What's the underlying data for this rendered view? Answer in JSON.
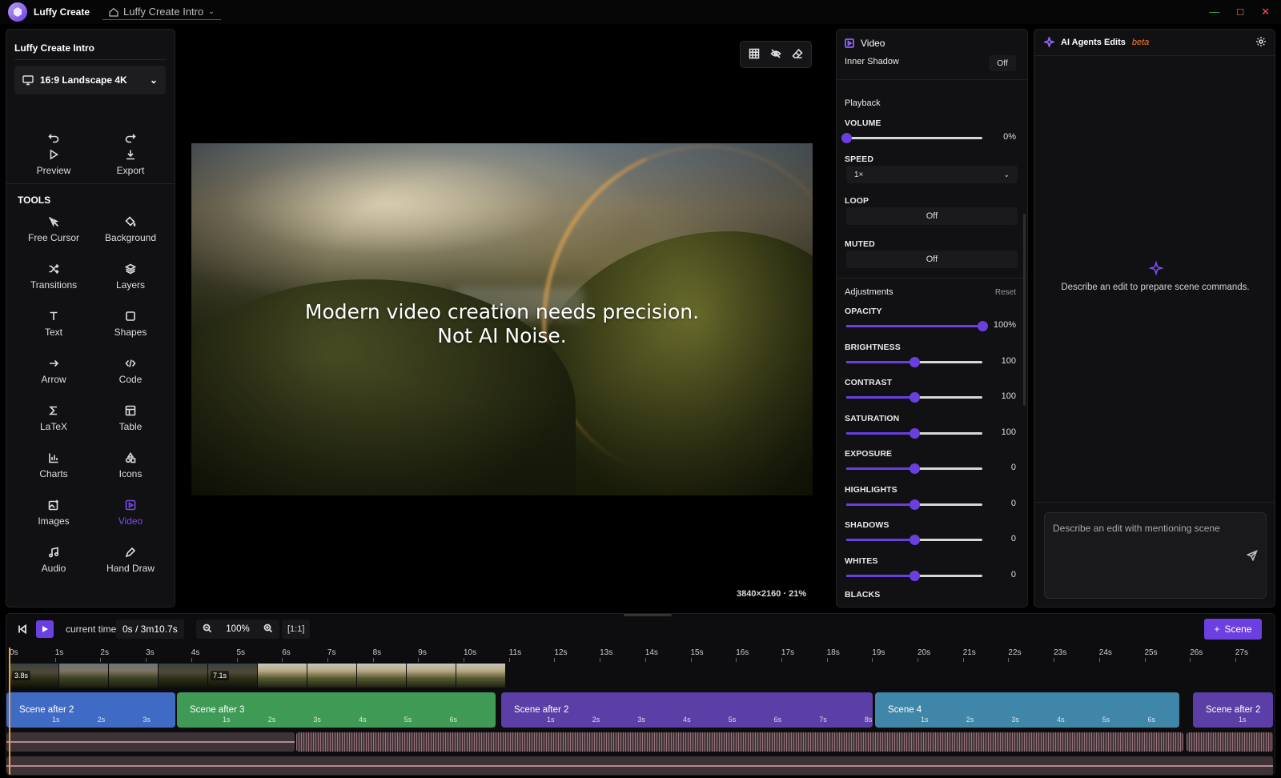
{
  "app": {
    "name": "Luffy Create",
    "document_tab": "Luffy Create Intro"
  },
  "left_panel": {
    "project_title": "Luffy Create Intro",
    "aspect_ratio": "16:9 Landscape 4K",
    "actions": [
      {
        "label": "Preview",
        "icon": "play-icon"
      },
      {
        "label": "Export",
        "icon": "download-icon"
      }
    ],
    "tools_heading": "TOOLS",
    "tools": [
      {
        "label": "Free Cursor",
        "icon": "cursor-off-icon"
      },
      {
        "label": "Background",
        "icon": "paint-bucket-icon"
      },
      {
        "label": "Transitions",
        "icon": "shuffle-icon"
      },
      {
        "label": "Layers",
        "icon": "layers-icon"
      },
      {
        "label": "Text",
        "icon": "text-icon"
      },
      {
        "label": "Shapes",
        "icon": "square-icon"
      },
      {
        "label": "Arrow",
        "icon": "arrow-right-icon"
      },
      {
        "label": "Code",
        "icon": "code-icon"
      },
      {
        "label": "LaTeX",
        "icon": "sigma-icon"
      },
      {
        "label": "Table",
        "icon": "table-icon"
      },
      {
        "label": "Charts",
        "icon": "bar-chart-icon"
      },
      {
        "label": "Icons",
        "icon": "shapes-icon"
      },
      {
        "label": "Images",
        "icon": "image-plus-icon"
      },
      {
        "label": "Video",
        "icon": "video-icon",
        "active": true
      },
      {
        "label": "Audio",
        "icon": "music-icon"
      },
      {
        "label": "Hand Draw",
        "icon": "pen-tool-icon"
      }
    ]
  },
  "canvas": {
    "overlay_line1": "Modern video creation needs precision.",
    "overlay_line2": "Not AI Noise.",
    "resolution": "3840×2160 · 21%"
  },
  "properties": {
    "title": "Video",
    "inner_shadow_label": "Inner Shadow",
    "inner_shadow_value": "Off",
    "playback_heading": "Playback",
    "volume_label": "VOLUME",
    "volume_value": "0%",
    "volume_level": 0,
    "speed_label": "SPEED",
    "speed_value": "1×",
    "loop_label": "LOOP",
    "loop_value": "Off",
    "muted_label": "MUTED",
    "muted_value": "Off",
    "adjustments_heading": "Adjustments",
    "reset_label": "Reset",
    "sliders": [
      {
        "label": "OPACITY",
        "value": "100%",
        "level": 1.0
      },
      {
        "label": "BRIGHTNESS",
        "value": "100",
        "level": 0.5
      },
      {
        "label": "CONTRAST",
        "value": "100",
        "level": 0.5
      },
      {
        "label": "SATURATION",
        "value": "100",
        "level": 0.5
      },
      {
        "label": "EXPOSURE",
        "value": "0",
        "level": 0.5
      },
      {
        "label": "HIGHLIGHTS",
        "value": "0",
        "level": 0.5
      },
      {
        "label": "SHADOWS",
        "value": "0",
        "level": 0.5
      },
      {
        "label": "WHITES",
        "value": "0",
        "level": 0.5
      }
    ],
    "blacks_label": "BLACKS"
  },
  "ai_panel": {
    "title": "AI Agents Edits",
    "beta": "beta",
    "empty_message": "Describe an edit to prepare scene commands.",
    "input_placeholder": "Describe an edit with mentioning scene"
  },
  "timeline": {
    "current_time_label": "current time:",
    "current_time_value": "0s / 3m10.7s",
    "zoom_value": "100%",
    "fit_label": "[1:1]",
    "add_scene_label": "Scene",
    "ruler": [
      "0s",
      "1s",
      "2s",
      "3s",
      "4s",
      "5s",
      "6s",
      "7s",
      "8s",
      "9s",
      "10s",
      "11s",
      "12s",
      "13s",
      "14s",
      "15s",
      "16s",
      "17s",
      "18s",
      "19s",
      "20s",
      "21s",
      "22s",
      "23s",
      "24s",
      "25s",
      "26s",
      "27s"
    ],
    "clip_badges": [
      "3.8s",
      "7.1s"
    ],
    "scenes": [
      {
        "name": "Scene after 2",
        "color": "#3f6bc4",
        "ticks": [
          "1s",
          "2s",
          "3s"
        ]
      },
      {
        "name": "Scene after 3",
        "color": "#3f9a55",
        "ticks": [
          "1s",
          "2s",
          "3s",
          "4s",
          "5s",
          "6s"
        ]
      },
      {
        "name": "Scene after 2",
        "color": "#5b3ea6",
        "ticks": [
          "1s",
          "2s",
          "3s",
          "4s",
          "5s",
          "6s",
          "7s",
          "8s"
        ]
      },
      {
        "name": "Scene 4",
        "color": "#3f86a8",
        "ticks": [
          "1s",
          "2s",
          "3s",
          "4s",
          "5s",
          "6s"
        ]
      },
      {
        "name": "Scene after 2",
        "color": "#5b3ea6",
        "ticks": [
          "1s"
        ]
      }
    ]
  }
}
